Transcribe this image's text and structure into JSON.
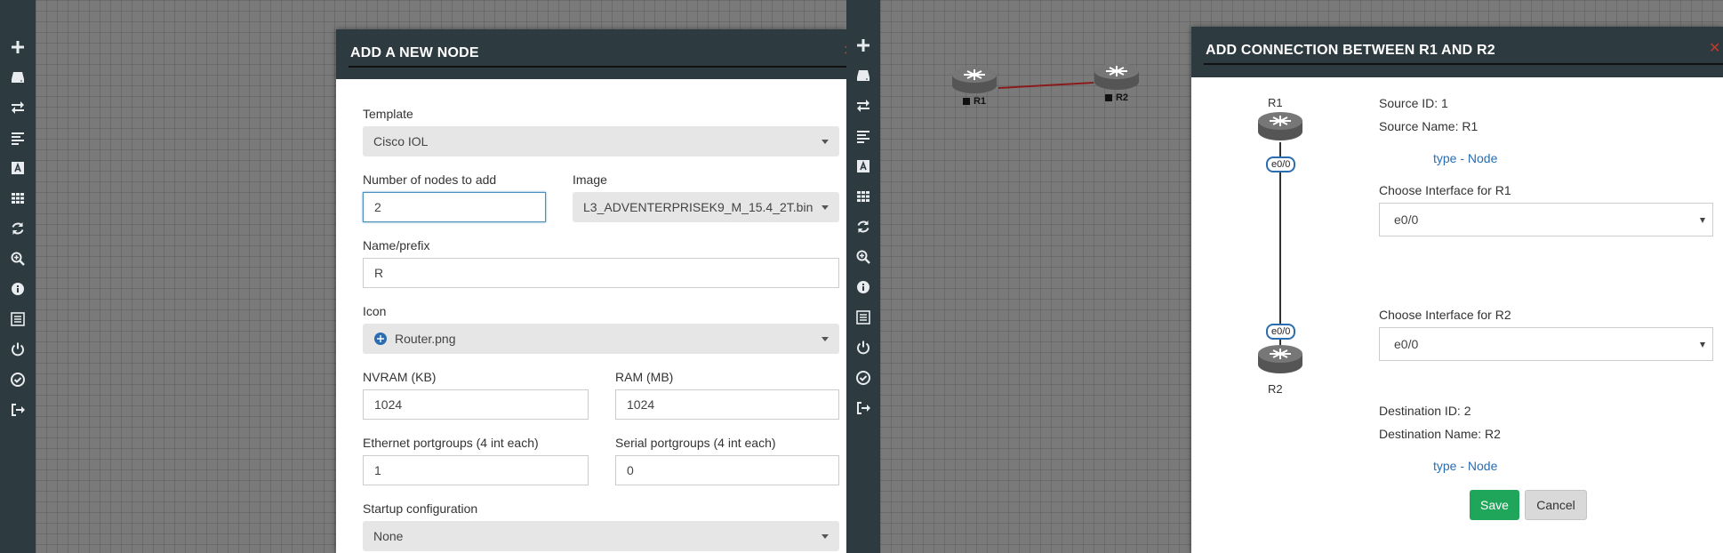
{
  "sidebar_icons": [
    "plus-icon",
    "drive-icon",
    "exchange-icon",
    "align-left-icon",
    "font-icon",
    "grid-icon",
    "refresh-icon",
    "zoom-in-icon",
    "info-icon",
    "list-icon",
    "power-icon",
    "check-circle-icon",
    "sign-out-icon"
  ],
  "add_node": {
    "title": "ADD A NEW NODE",
    "template_label": "Template",
    "template_value": "Cisco IOL",
    "num_nodes_label": "Number of nodes to add",
    "num_nodes_value": "2",
    "image_label": "Image",
    "image_value": "L3_ADVENTERPRISEK9_M_15.4_2T.bin",
    "name_label": "Name/prefix",
    "name_value": "R",
    "icon_label": "Icon",
    "icon_value": "Router.png",
    "nvram_label": "NVRAM (KB)",
    "nvram_value": "1024",
    "ram_label": "RAM (MB)",
    "ram_value": "1024",
    "eth_label": "Ethernet portgroups (4 int each)",
    "eth_value": "1",
    "serial_label": "Serial portgroups (4 int each)",
    "serial_value": "0",
    "startup_label": "Startup configuration",
    "startup_value": "None"
  },
  "topology": {
    "node1_label": "R1",
    "node2_label": "R2",
    "link_color": "#8b1a1a"
  },
  "add_connection": {
    "title": "ADD CONNECTION BETWEEN R1 AND R2",
    "r1_label": "R1",
    "r2_label": "R2",
    "if1_badge": "e0/0",
    "if2_badge": "e0/0",
    "source_id": "Source ID: 1",
    "source_name": "Source Name: R1",
    "source_type": "type - Node",
    "choose_r1": "Choose Interface for R1",
    "r1_interface": "e0/0",
    "choose_r2": "Choose Interface for R2",
    "r2_interface": "e0/0",
    "dest_id": "Destination ID: 2",
    "dest_name": "Destination Name: R2",
    "dest_type": "type - Node",
    "save_label": "Save",
    "cancel_label": "Cancel"
  },
  "colors": {
    "header_bg": "#2d3a40",
    "save_green": "#1fa65a",
    "link_blue": "#2a6db0",
    "close_red": "#c0392b"
  }
}
